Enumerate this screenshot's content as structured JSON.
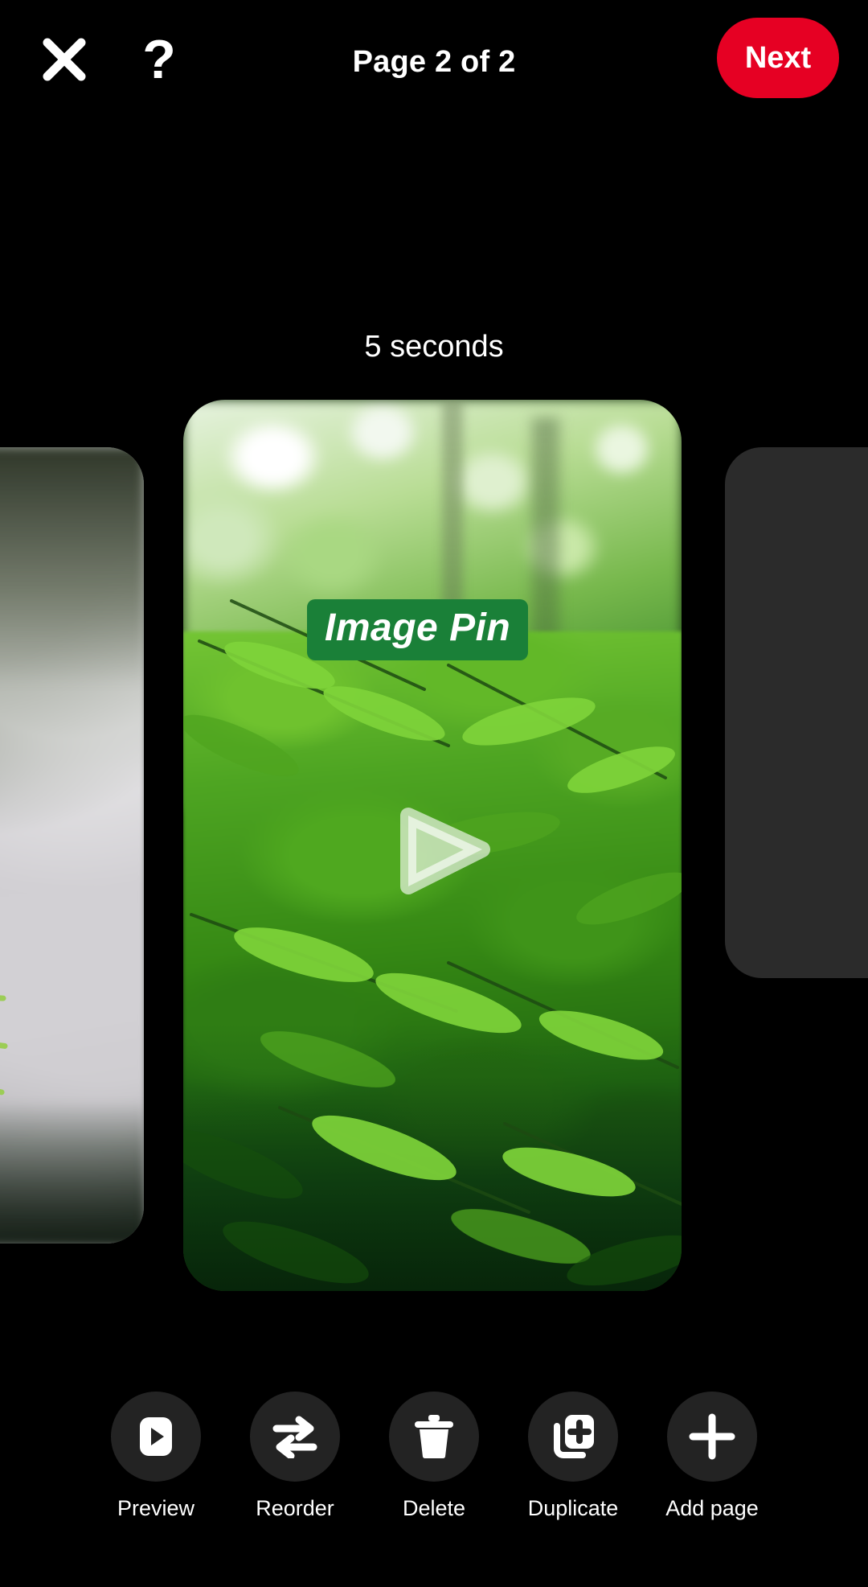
{
  "header": {
    "close_icon": "close-icon",
    "help_icon": "help-icon",
    "help_glyph": "?",
    "title": "Page 2 of 2",
    "next_label": "Next",
    "next_color": "#E60023"
  },
  "editor": {
    "duration_label": "5 seconds",
    "sticker_text": "Image Pin",
    "sticker_color": "#1A8038",
    "play_overlay_icon": "play-icon",
    "card_background": "forest-fern-photo",
    "peek_left_background": "blurred-fern-rock-photo",
    "peek_right_background": "empty-page-placeholder"
  },
  "toolbar": {
    "items": [
      {
        "label": "Preview",
        "icon": "play-preview-icon"
      },
      {
        "label": "Reorder",
        "icon": "reorder-arrows-icon"
      },
      {
        "label": "Delete",
        "icon": "trash-icon"
      },
      {
        "label": "Duplicate",
        "icon": "duplicate-page-icon"
      },
      {
        "label": "Add page",
        "icon": "plus-icon"
      }
    ]
  }
}
